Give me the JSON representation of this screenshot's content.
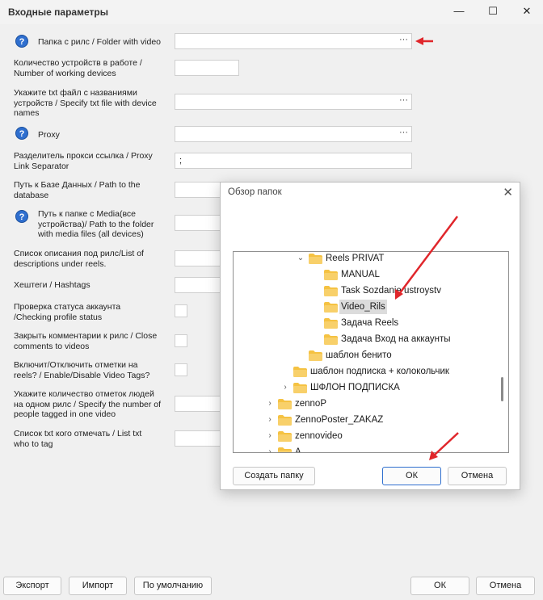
{
  "window": {
    "title": "Входные параметры",
    "minimize": "—",
    "maximize": "☐",
    "close": "✕"
  },
  "fields": {
    "folder_video": {
      "label": "Папка с рилс / Folder with video",
      "browse": "···"
    },
    "device_count": {
      "label_1": "Количество устройств в работе /",
      "label_2": "Number of working devices"
    },
    "device_names": {
      "label_1": "Укажите txt файл с названиями",
      "label_2": "устройств / Specify txt file with device",
      "label_3": "names",
      "browse": "···"
    },
    "proxy": {
      "label": "Proxy",
      "browse": "···"
    },
    "proxy_sep": {
      "label_1": "Разделитель прокси ссылка / Proxy",
      "label_2": "Link Separator",
      "value": ";"
    },
    "db_path": {
      "label_1": "Путь к Базе Данных / Path to the",
      "label_2": "database"
    },
    "media_folder": {
      "label_1": "Путь к папке с Media(все",
      "label_2": "устройства)/ Path to the folder",
      "label_3": "with media files (all devices)"
    },
    "descriptions": {
      "label_1": "Список описания под рилс/List of",
      "label_2": "descriptions under reels."
    },
    "hashtags": {
      "label": "Хештеги / Hashtags"
    },
    "check_status": {
      "label_1": "Проверка статуса аккаунта",
      "label_2": "/Checking profile status"
    },
    "close_comments": {
      "label_1": "Закрыть комментарии к рилс / Close",
      "label_2": "comments to videos"
    },
    "video_tags": {
      "label_1": "Включит/Отключить отметки на",
      "label_2": "reels? / Enable/Disable Video Tags?"
    },
    "tag_count": {
      "label_1": "Укажите количество отметок людей",
      "label_2": "на одном рилс / Specify the number of",
      "label_3": "people tagged in one video"
    },
    "tag_list": {
      "label_1": "Список txt  кого отмечать / List txt",
      "label_2": "who to tag"
    }
  },
  "footer": {
    "export": "Экспорт",
    "import": "Импорт",
    "defaults": "По умолчанию",
    "ok": "ОК",
    "cancel": "Отмена"
  },
  "dialog": {
    "title": "Обзор папок",
    "close": "✕",
    "tree": [
      {
        "label": "Reels PRIVAT",
        "arrow": "⌄"
      },
      {
        "label": "MANUAL",
        "arrow": ""
      },
      {
        "label": "Task Sozdanie ustroystv",
        "arrow": ""
      },
      {
        "label": "Video_Rils",
        "arrow": ""
      },
      {
        "label": "Задача Reels",
        "arrow": ""
      },
      {
        "label": "Задача Вход на аккаунты",
        "arrow": ""
      },
      {
        "label": "шаблон бенито",
        "arrow": ""
      },
      {
        "label": "шаблон подписка + колокольчик",
        "arrow": ""
      },
      {
        "label": "ШФЛОН ПОДПИСКА",
        "arrow": "›"
      },
      {
        "label": "zennoP",
        "arrow": "›"
      },
      {
        "label": "ZennoPoster_ZAKAZ",
        "arrow": "›"
      },
      {
        "label": "zennovideo",
        "arrow": "›"
      },
      {
        "label": "A...",
        "arrow": "›"
      }
    ],
    "new_folder": "Создать папку",
    "ok": "ОК",
    "cancel": "Отмена"
  },
  "colors": {
    "accent_arrow": "#e0262b",
    "folder": "#f5c242",
    "help_icon": "#2f6fcf"
  }
}
